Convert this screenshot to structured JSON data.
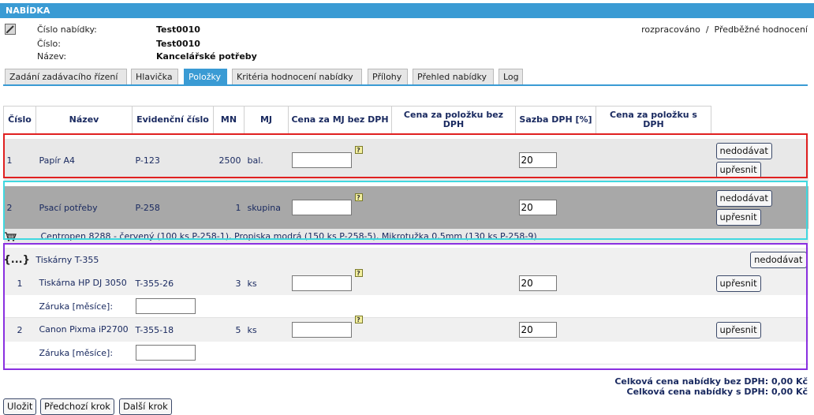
{
  "header": {
    "title": "NABÍDKA",
    "offer_number_label": "Číslo nabídky:",
    "offer_number": "Test0010",
    "number_label": "Číslo:",
    "number": "Test0010",
    "name_label": "Název:",
    "name": "Kancelářské potřeby",
    "status": "rozpracováno  /  Předběžné hodnocení"
  },
  "tabs": [
    {
      "label": "Zadání zadávacího řízení",
      "active": false
    },
    {
      "label": "Hlavička",
      "active": false
    },
    {
      "label": "Položky",
      "active": true
    },
    {
      "label": "Kritéria hodnocení nabídky",
      "active": false
    },
    {
      "label": "Přílohy",
      "active": false
    },
    {
      "label": "Přehled nabídky",
      "active": false
    },
    {
      "label": "Log",
      "active": false
    }
  ],
  "table": {
    "columns": {
      "cislo": "Číslo",
      "nazev": "Název",
      "evidencni": "Evidenční číslo",
      "mn": "MN",
      "mj": "MJ",
      "cena_mj": "Cena za MJ bez DPH",
      "cena_polozka": "Cena za položku bez DPH",
      "sazba": "Sazba DPH [%]",
      "cena_s_dph": "Cena za položku s DPH"
    },
    "rows": [
      {
        "cislo": "1",
        "nazev": "Papír A4",
        "evidencni": "P-123",
        "mn": "2500",
        "mj": "bal.",
        "cena": "",
        "sazba": "20"
      },
      {
        "cislo": "2",
        "nazev": "Psací potřeby",
        "evidencni": "P-258",
        "mn": "1",
        "mj": "skupina",
        "cena": "",
        "sazba": "20",
        "detail": "Centropen 8288 - červený (100 ks P-258-1), Propiska modrá (150 ks P-258-5), Mikrotužka 0,5mm (130 ks P-258-9)"
      }
    ],
    "group": {
      "icon_text": "{...}",
      "name": "Tiskárny T-355",
      "items": [
        {
          "cislo": "1",
          "nazev": "Tiskárna HP DJ 3050",
          "evidencni": "T-355-26",
          "mn": "3",
          "mj": "ks",
          "cena": "",
          "sazba": "20",
          "warranty_label": "Záruka [měsíce]:",
          "warranty_value": ""
        },
        {
          "cislo": "2",
          "nazev": "Canon Pixma iP2700",
          "evidencni": "T-355-18",
          "mn": "5",
          "mj": "ks",
          "cena": "",
          "sazba": "20",
          "warranty_label": "Záruka [měsíce]:",
          "warranty_value": ""
        }
      ]
    }
  },
  "buttons": {
    "nedodavat": "nedodávat",
    "upresnit": "upřesnit",
    "help": "?",
    "save": "Uložit",
    "prev": "Předchozí krok",
    "next": "Další krok"
  },
  "totals": {
    "without_vat": "Celková cena nabídky bez DPH: 0,00 Kč",
    "with_vat": "Celková cena nabídky s DPH: 0,00 Kč"
  },
  "colors": {
    "accent": "#3a9bd4",
    "highlight_red": "#e02020",
    "highlight_cyan": "#40d8e0",
    "highlight_purple": "#8a30e0"
  }
}
